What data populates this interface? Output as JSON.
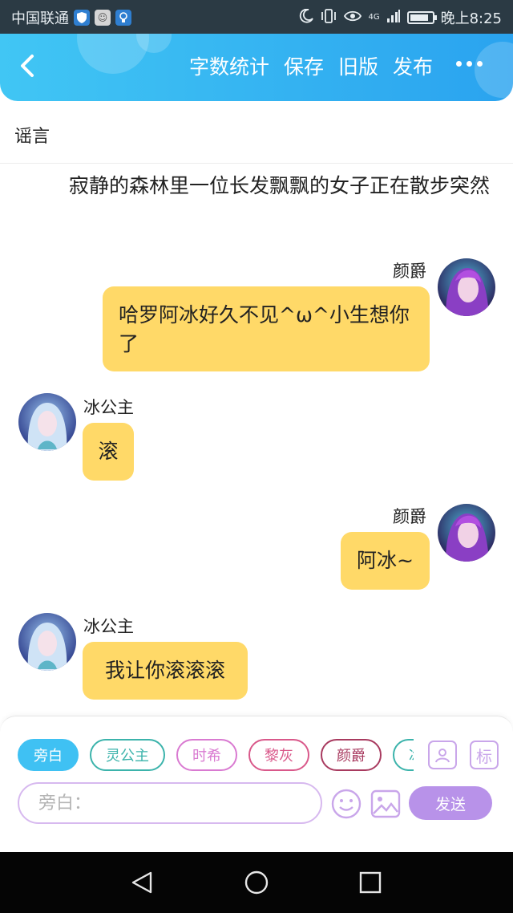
{
  "status_bar": {
    "carrier": "中国联通",
    "time": "晚上8:25",
    "network": "4G",
    "battery_level": 0.85
  },
  "header": {
    "actions": [
      "字数统计",
      "保存",
      "旧版",
      "发布"
    ]
  },
  "story": {
    "title": "谣言",
    "narration": "寂静的森林里一位长发飘飘的女子正在散步突然"
  },
  "messages": [
    {
      "speaker": "颜爵",
      "side": "right",
      "text": "哈罗阿冰好久不见^ω^小生想你了"
    },
    {
      "speaker": "冰公主",
      "side": "left",
      "text": "滚"
    },
    {
      "speaker": "颜爵",
      "side": "right",
      "text": "阿冰~"
    },
    {
      "speaker": "冰公主",
      "side": "left",
      "text": "我让你滚滚滚"
    }
  ],
  "composer": {
    "chips": [
      {
        "label": "旁白",
        "color": "#3fc1f3"
      },
      {
        "label": "灵公主",
        "color": "#3bb3ab"
      },
      {
        "label": "时希",
        "color": "#d97ad1"
      },
      {
        "label": "黎灰",
        "color": "#d9588a"
      },
      {
        "label": "颜爵",
        "color": "#a83a5f"
      },
      {
        "label": "冰",
        "color": "#3bb3ab"
      }
    ],
    "icon_role": "person-card-icon",
    "icon_tag": "标",
    "input_placeholder": "旁白：",
    "send_label": "发送"
  },
  "colors": {
    "header_gradient_start": "#41c6f4",
    "header_gradient_end": "#2aa3ef",
    "bubble": "#ffd968",
    "accent_purple": "#b892e9"
  }
}
